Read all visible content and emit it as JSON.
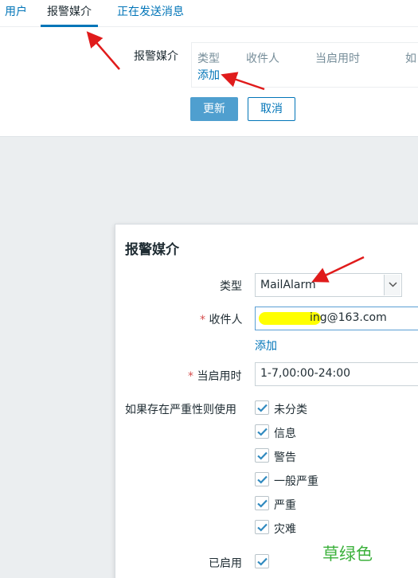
{
  "tabs": [
    {
      "label": "用户"
    },
    {
      "label": "报警媒介"
    },
    {
      "label": "正在发送消息"
    }
  ],
  "media_section": {
    "label": "报警媒介",
    "columns": [
      "类型",
      "收件人",
      "当启用时",
      "如"
    ],
    "add_link": "添加"
  },
  "buttons": {
    "update": "更新",
    "cancel": "取消"
  },
  "dialog": {
    "title": "报警媒介",
    "type_label": "类型",
    "type_value": "MailAlarm",
    "recipient_label": "收件人",
    "recipient_value": "ing@163.com",
    "recipient_add": "添加",
    "when_active_label": "当启用时",
    "when_active_value": "1-7,00:00-24:00",
    "severity_label": "如果存在严重性则使用",
    "severities": [
      "未分类",
      "信息",
      "警告",
      "一般严重",
      "严重",
      "灾难"
    ],
    "enabled_label": "已启用",
    "required_mark": "*"
  },
  "annotation": "草绿色",
  "colors": {
    "link": "#0275b8",
    "primary_button": "#4f9fcf",
    "required": "#d64e4e",
    "annotation_arrow": "#e01b1b",
    "annotation_text": "#3cb13c",
    "redaction": "#ffff00"
  }
}
